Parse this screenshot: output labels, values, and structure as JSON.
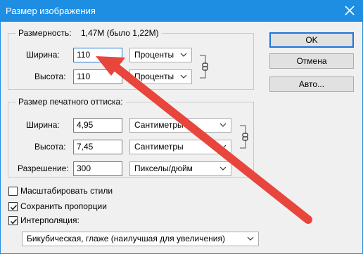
{
  "window": {
    "title": "Размер изображения"
  },
  "pixel_dims": {
    "label": "Размерность:",
    "size_text": "1,47M (было 1,22M)",
    "width_label": "Ширина:",
    "width_value": "110",
    "width_unit": "Проценты",
    "height_label": "Высота:",
    "height_value": "110",
    "height_unit": "Проценты"
  },
  "print_size": {
    "title": "Размер печатного оттиска:",
    "width_label": "Ширина:",
    "width_value": "4,95",
    "width_unit": "Сантиметры",
    "height_label": "Высота:",
    "height_value": "7,45",
    "height_unit": "Сантиметры",
    "resolution_label": "Разрешение:",
    "resolution_value": "300",
    "resolution_unit": "Пикселы/дюйм"
  },
  "buttons": {
    "ok": "OK",
    "cancel": "Отмена",
    "auto": "Авто..."
  },
  "options": {
    "scale_styles": {
      "label": "Масштабировать стили",
      "checked": false
    },
    "constrain": {
      "label": "Сохранить пропорции",
      "checked": true
    },
    "resample": {
      "label": "Интерполяция:",
      "checked": true
    },
    "method": "Бикубическая, глаже (наилучшая для увеличения)"
  },
  "colors": {
    "title_bar": "#1e8ee3",
    "focus": "#1e73d8",
    "annotation_arrow": "#e8453c"
  }
}
